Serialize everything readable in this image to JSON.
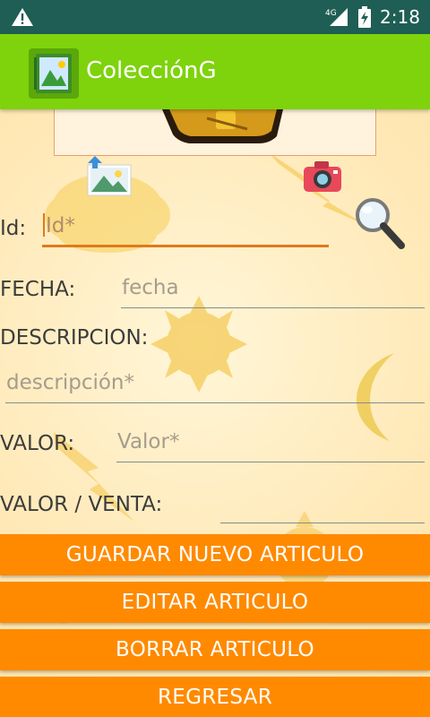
{
  "status_bar": {
    "time": "2:18",
    "network": "4G",
    "icons": [
      "warning-icon",
      "signal-icon",
      "battery-icon"
    ]
  },
  "app_bar": {
    "title": "ColecciónG",
    "icon": "app-logo-icon",
    "color": "#7ed30c"
  },
  "form": {
    "id_label": "Id:",
    "id_placeholder": "Id*",
    "fecha_label": "FECHA:",
    "fecha_placeholder": "fecha",
    "descripcion_label": "DESCRIPCION:",
    "descripcion_placeholder": "descripción*",
    "valor_label": "VALOR:",
    "valor_placeholder": "Valor*",
    "valor_venta_label": "VALOR / VENTA:",
    "valor_venta_value": ""
  },
  "icons": {
    "gallery": "image-upload-icon",
    "camera": "camera-icon",
    "search": "search-icon"
  },
  "buttons": {
    "save": "GUARDAR NUEVO ARTICULO",
    "edit": "EDITAR ARTICULO",
    "delete": "BORRAR ARTICULO",
    "back": "REGRESAR"
  },
  "colors": {
    "status_bar": "#1f5e54",
    "accent": "#ff8a00",
    "input_focus": "#e07a1a"
  }
}
